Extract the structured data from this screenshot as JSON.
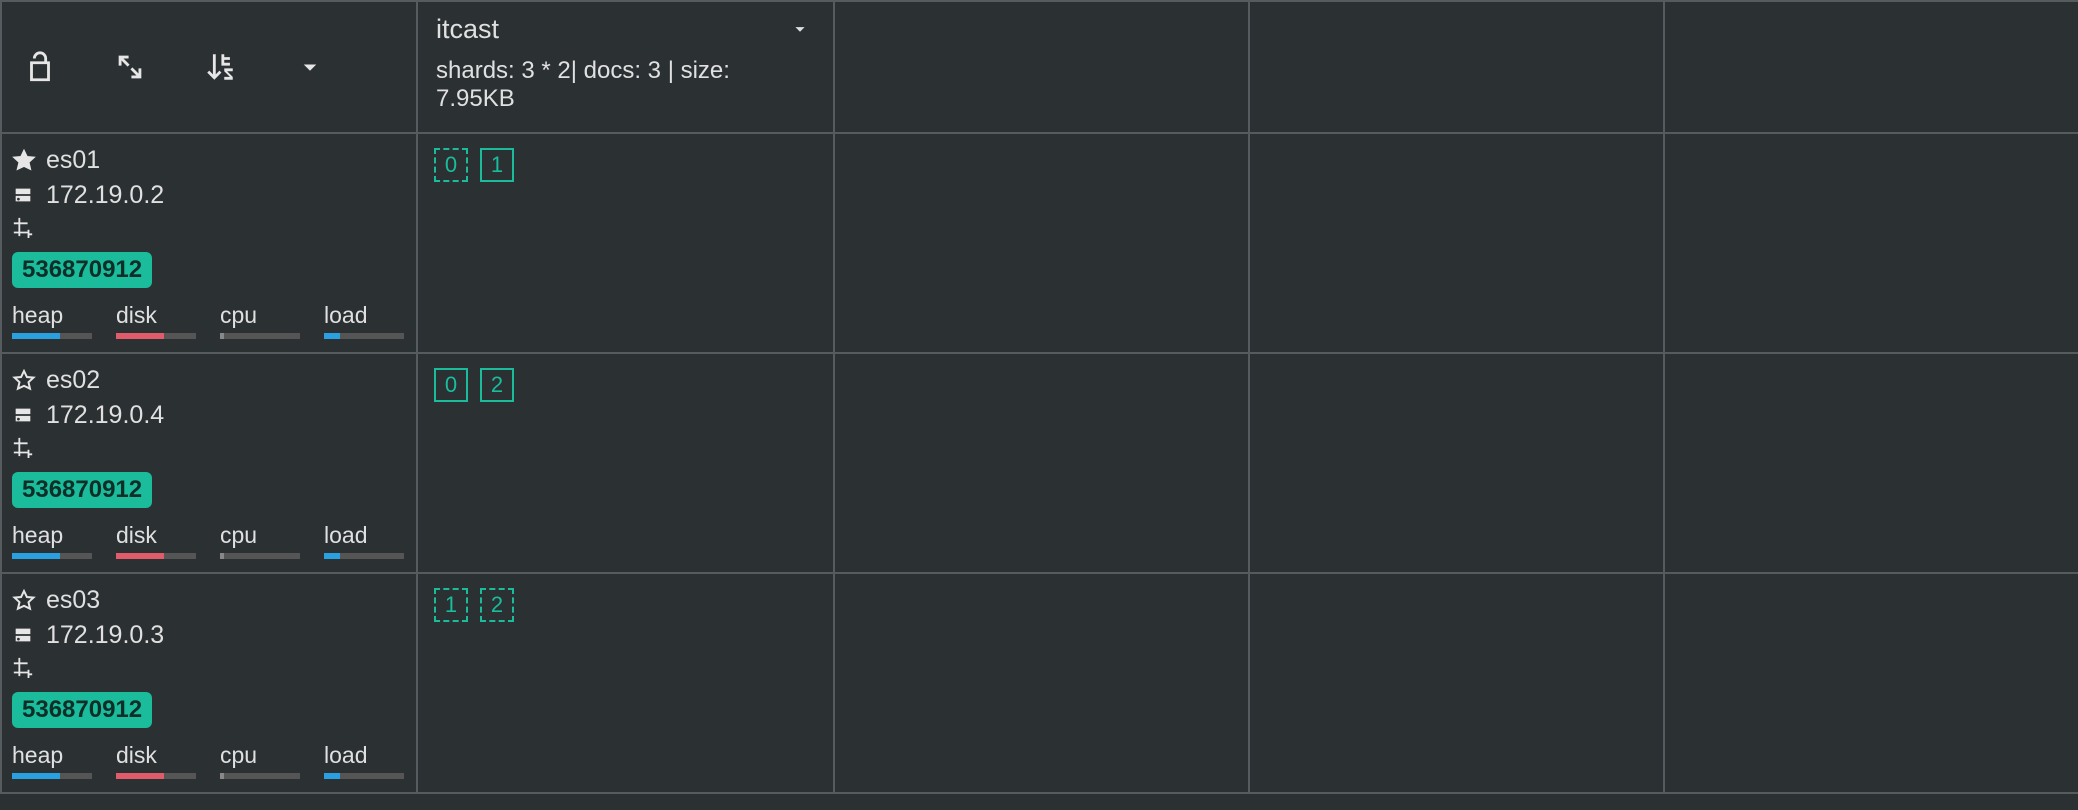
{
  "toolbar": {
    "icons": {
      "lock": "lock-open",
      "expand": "expand",
      "sort": "sort-az",
      "dropdown": "caret-down"
    }
  },
  "index": {
    "name": "itcast",
    "stats": "shards: 3 * 2| docs: 3 | size: 7.95KB"
  },
  "metric_labels": {
    "heap": "heap",
    "disk": "disk",
    "cpu": "cpu",
    "load": "load"
  },
  "colors": {
    "shard_green": "#1abc9c",
    "bg": "#2b3033",
    "border": "#555b5e",
    "heap_bar": "#2aa0e0",
    "disk_bar": "#e05c6a",
    "load_bar": "#2aa0e0"
  },
  "nodes": [
    {
      "name": "es01",
      "is_master": true,
      "ip": "172.19.0.2",
      "tag": "536870912",
      "metrics": {
        "heap": 60,
        "disk": 60,
        "cpu": 5,
        "load": 20
      },
      "shards": [
        {
          "id": "0",
          "type": "replica"
        },
        {
          "id": "1",
          "type": "primary"
        }
      ]
    },
    {
      "name": "es02",
      "is_master": false,
      "ip": "172.19.0.4",
      "tag": "536870912",
      "metrics": {
        "heap": 60,
        "disk": 60,
        "cpu": 5,
        "load": 20
      },
      "shards": [
        {
          "id": "0",
          "type": "primary"
        },
        {
          "id": "2",
          "type": "primary"
        }
      ]
    },
    {
      "name": "es03",
      "is_master": false,
      "ip": "172.19.0.3",
      "tag": "536870912",
      "metrics": {
        "heap": 60,
        "disk": 60,
        "cpu": 5,
        "load": 20
      },
      "shards": [
        {
          "id": "1",
          "type": "replica"
        },
        {
          "id": "2",
          "type": "replica"
        }
      ]
    }
  ]
}
